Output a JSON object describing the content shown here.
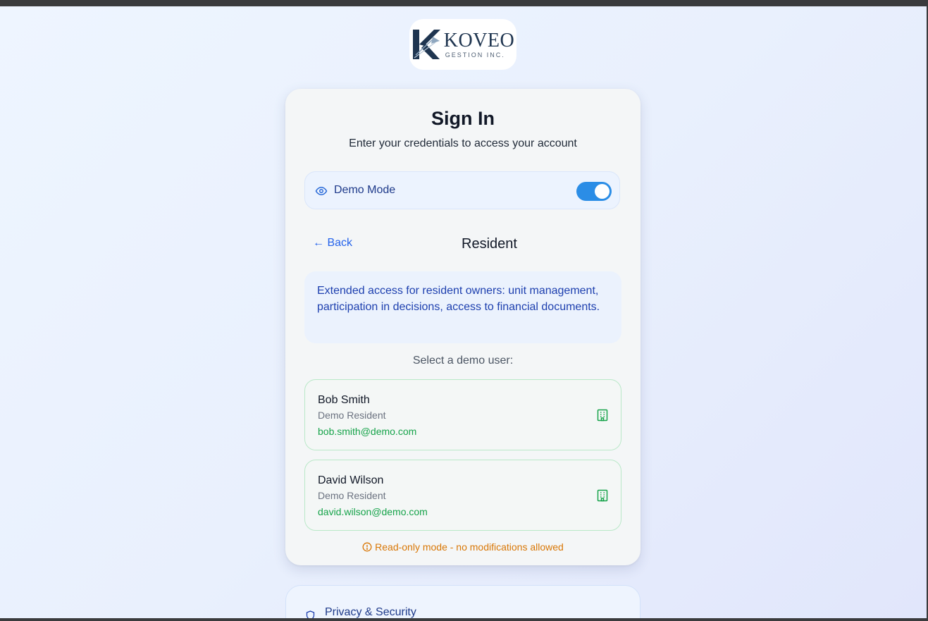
{
  "brand": {
    "name": "KOVEO",
    "subtitle": "GESTION INC."
  },
  "signin": {
    "title": "Sign In",
    "subtitle": "Enter your credentials to access your account"
  },
  "demo_mode": {
    "label": "Demo Mode",
    "enabled": true,
    "icon": "eye-icon"
  },
  "role_panel": {
    "back_label": "← Back",
    "role_title": "Resident",
    "description": "Extended access for resident owners: unit management, participation in decisions, access to financial documents.",
    "select_prompt": "Select a demo user:"
  },
  "demo_users": [
    {
      "name": "Bob Smith",
      "role": "Demo Resident",
      "email": "bob.smith@demo.com",
      "icon": "building-icon"
    },
    {
      "name": "David Wilson",
      "role": "Demo Resident",
      "email": "david.wilson@demo.com",
      "icon": "building-icon"
    }
  ],
  "readonly_notice": "Read-only mode - no modifications allowed",
  "privacy": {
    "label": "Privacy & Security",
    "icon": "shield-icon"
  },
  "colors": {
    "primary": "#2b8de6",
    "link": "#2563eb",
    "success": "#16a34a",
    "warning": "#d97706",
    "navy": "#1e3a8a"
  }
}
